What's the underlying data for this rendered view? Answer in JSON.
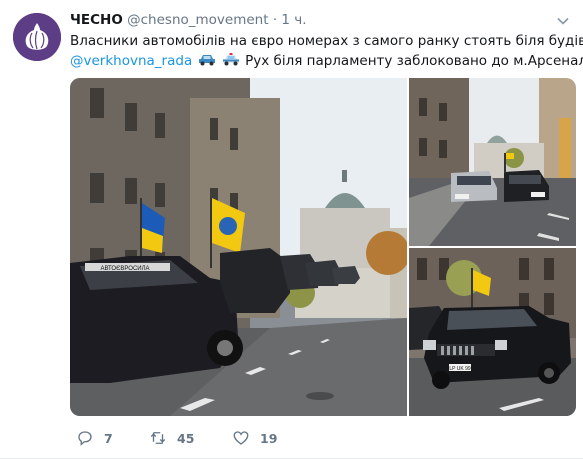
{
  "tweet": {
    "author_name": "ЧЕСНО",
    "author_handle": "@chesno_movement",
    "separator": "·",
    "time": "1 ч.",
    "text_line1": "Власники автомобілів на євро номерах з самого ранку стоять біля будівлі",
    "mention": "@verkhovna_rada",
    "text_line2_after": "Рух біля парламенту заблоковано до м.Арсенальна",
    "emojis": [
      "car-emoji",
      "police-car-emoji"
    ]
  },
  "photos": {
    "main": {
      "description_icon": "photo",
      "windshield_sign": "АВТОЄВРОСИЛА"
    },
    "top_right": {
      "description_icon": "photo"
    },
    "bottom_right": {
      "description_icon": "photo",
      "plate": "LP UK 99"
    }
  },
  "actions": {
    "reply_count": "7",
    "retweet_count": "45",
    "like_count": "19"
  },
  "colors": {
    "accent": "#1b95e0",
    "secondary_text": "#657786",
    "avatar_bg": "#5c3d86"
  }
}
